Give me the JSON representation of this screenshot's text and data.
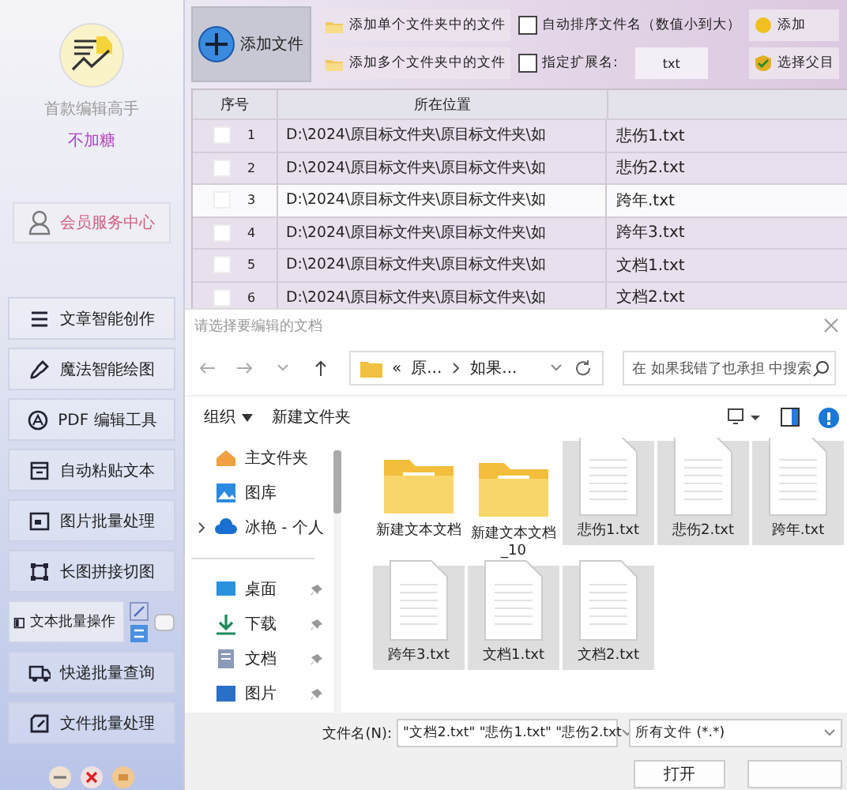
{
  "app": {
    "name": "首款编辑高手",
    "tagline": "不加糖",
    "member_button": "会员服务中心"
  },
  "sidebar": {
    "items": [
      {
        "label": "文章智能创作",
        "selected": false
      },
      {
        "label": "魔法智能绘图",
        "selected": false
      },
      {
        "label": "PDF 编辑工具",
        "selected": false
      },
      {
        "label": "自动粘贴文本",
        "selected": false
      },
      {
        "label": "图片批量处理",
        "selected": false
      },
      {
        "label": "长图拼接切图",
        "selected": false
      },
      {
        "label": "文本批量操作",
        "selected": true
      },
      {
        "label": "快递批量查询",
        "selected": false
      },
      {
        "label": "文件批量处理",
        "selected": false
      }
    ]
  },
  "toolbar": {
    "add_files": "添加文件",
    "add_single_folder": "添加单个文件夹中的文件",
    "add_multi_folder": "添加多个文件夹中的文件",
    "auto_sort": {
      "label": "自动排序文件名（数值小到大）",
      "checked": false
    },
    "extension": {
      "label": "指定扩展名:",
      "checked": false,
      "value": "txt"
    },
    "right_buttons": [
      "添加",
      "选择父目"
    ]
  },
  "table": {
    "columns": [
      "序号",
      "所在位置"
    ],
    "rows": [
      {
        "index": "1",
        "checked": false,
        "selected": false,
        "path": "D:\\2024\\原目标文件夹\\原目标文件夹\\如",
        "name": "悲伤1.txt"
      },
      {
        "index": "2",
        "checked": false,
        "selected": false,
        "path": "D:\\2024\\原目标文件夹\\原目标文件夹\\如",
        "name": "悲伤2.txt"
      },
      {
        "index": "3",
        "checked": false,
        "selected": true,
        "path": "D:\\2024\\原目标文件夹\\原目标文件夹\\如",
        "name": "跨年.txt"
      },
      {
        "index": "4",
        "checked": false,
        "selected": false,
        "path": "D:\\2024\\原目标文件夹\\原目标文件夹\\如",
        "name": "跨年3.txt"
      },
      {
        "index": "5",
        "checked": false,
        "selected": false,
        "path": "D:\\2024\\原目标文件夹\\原目标文件夹\\如",
        "name": "文档1.txt"
      },
      {
        "index": "6",
        "checked": false,
        "selected": false,
        "path": "D:\\2024\\原目标文件夹\\原目标文件夹\\如",
        "name": "文档2.txt"
      }
    ]
  },
  "dialog": {
    "title": "请选择要编辑的文档",
    "overflow_marker": "«",
    "breadcrumb": [
      "原...",
      "如果..."
    ],
    "search_placeholder": "在 如果我错了也承担 中搜索",
    "organize": "组织",
    "new_folder": "新建文件夹",
    "nav": [
      {
        "label": "主文件夹",
        "kind": "home",
        "pinned": false,
        "expandable": false
      },
      {
        "label": "图库",
        "kind": "gallery",
        "pinned": false,
        "expandable": false
      },
      {
        "label": "冰艳 - 个人",
        "kind": "cloud",
        "pinned": false,
        "expandable": true
      },
      {
        "label": "桌面",
        "kind": "desktop",
        "pinned": true,
        "expandable": false
      },
      {
        "label": "下载",
        "kind": "download",
        "pinned": true,
        "expandable": false
      },
      {
        "label": "文档",
        "kind": "documents",
        "pinned": true,
        "expandable": false
      },
      {
        "label": "图片",
        "kind": "pictures",
        "pinned": true,
        "expandable": false
      }
    ],
    "files": [
      {
        "name": "新建文本文档",
        "kind": "folder",
        "selected": false
      },
      {
        "name": "新建文本文档_10",
        "kind": "folder",
        "selected": false
      },
      {
        "name": "悲伤1.txt",
        "kind": "text",
        "selected": true
      },
      {
        "name": "悲伤2.txt",
        "kind": "text",
        "selected": true
      },
      {
        "name": "跨年.txt",
        "kind": "text",
        "selected": true
      },
      {
        "name": "跨年3.txt",
        "kind": "text",
        "selected": true
      },
      {
        "name": "文档1.txt",
        "kind": "text",
        "selected": true
      },
      {
        "name": "文档2.txt",
        "kind": "text",
        "selected": true
      }
    ],
    "filename_label": "文件名(N):",
    "filename_value": "\"文档2.txt\" \"悲伤1.txt\" \"悲伤2.txt",
    "filetype": "所有文件 (*.*)",
    "open_button": "打开"
  }
}
